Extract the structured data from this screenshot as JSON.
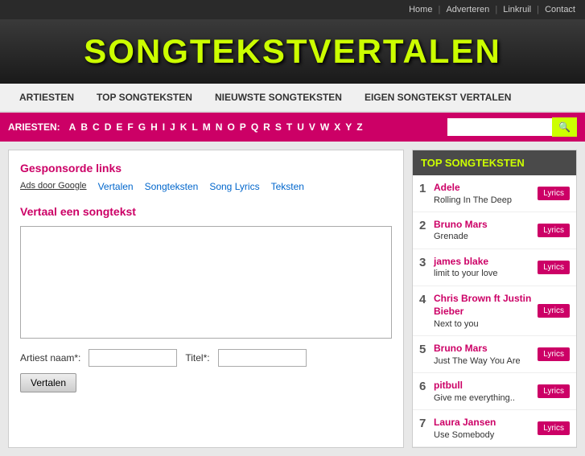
{
  "topnav": {
    "links": [
      "Home",
      "Adverteren",
      "Linkruil",
      "Contact"
    ]
  },
  "logo": {
    "text": "songtekstvertalen"
  },
  "mainnav": {
    "links": [
      "ARTIESTEN",
      "TOP SONGTEKSTEN",
      "NIEUWSTE SONGTEKSTEN",
      "EIGEN SONGTEKST VERTALEN"
    ]
  },
  "alphabar": {
    "label": "ARIESTEN:",
    "letters": [
      "A",
      "B",
      "C",
      "D",
      "E",
      "F",
      "G",
      "H",
      "I",
      "J",
      "K",
      "L",
      "M",
      "N",
      "O",
      "P",
      "Q",
      "R",
      "S",
      "T",
      "U",
      "V",
      "W",
      "X",
      "Y",
      "Z"
    ],
    "search_placeholder": ""
  },
  "left": {
    "sponsored_title": "Gesponsorde links",
    "ads_label": "Ads door Google",
    "ad_links": [
      "Vertalen",
      "Songteksten",
      "Song Lyrics",
      "Teksten"
    ],
    "translate_title": "Vertaal een songtekst",
    "textarea_placeholder": "",
    "artist_label": "Artiest naam*:",
    "title_label": "Titel*:",
    "button_label": "Vertalen"
  },
  "right": {
    "header": "TOP SONGTEKSTEN",
    "songs": [
      {
        "num": "1",
        "artist": "Adele",
        "title": "Rolling In The Deep",
        "btn": "Lyrics"
      },
      {
        "num": "2",
        "artist": "Bruno Mars",
        "title": "Grenade",
        "btn": "Lyrics"
      },
      {
        "num": "3",
        "artist": "james blake",
        "title": "limit to your love",
        "btn": "Lyrics"
      },
      {
        "num": "4",
        "artist": "Chris Brown ft Justin Bieber",
        "title": "Next to you",
        "btn": "Lyrics"
      },
      {
        "num": "5",
        "artist": "Bruno Mars",
        "title": "Just The Way You Are",
        "btn": "Lyrics"
      },
      {
        "num": "6",
        "artist": "pitbull",
        "title": "Give me everything..",
        "btn": "Lyrics"
      },
      {
        "num": "7",
        "artist": "Laura Jansen",
        "title": "Use Somebody",
        "btn": "Lyrics"
      }
    ]
  }
}
